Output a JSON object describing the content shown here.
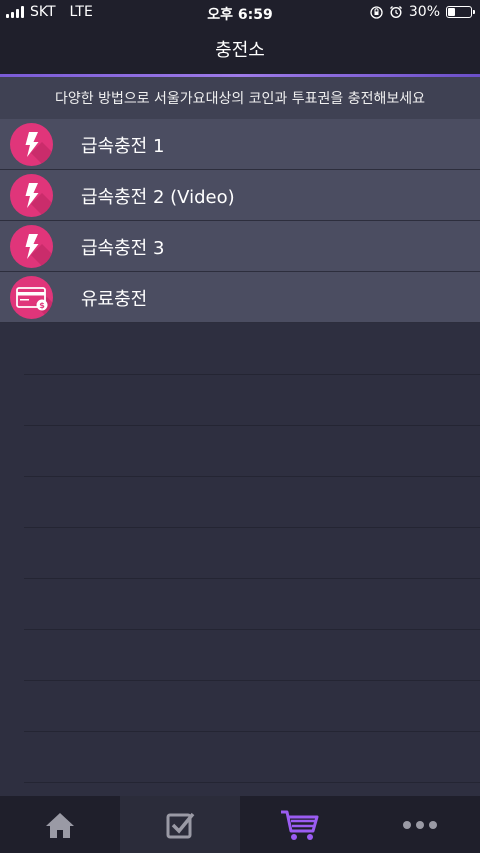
{
  "status_bar": {
    "carrier": "SKT",
    "network": "LTE",
    "time": "오후 6:59",
    "battery_percent": "30%",
    "battery_level": 0.3
  },
  "header": {
    "title": "충전소"
  },
  "notice": {
    "text": "다양한 방법으로 서울가요대상의 코인과 투표권을 충전해보세요"
  },
  "menu": {
    "items": [
      {
        "label": "급속충전 1",
        "icon": "lightning-icon"
      },
      {
        "label": "급속충전 2 (Video)",
        "icon": "lightning-icon"
      },
      {
        "label": "급속충전 3",
        "icon": "lightning-icon"
      },
      {
        "label": "유료충전",
        "icon": "credit-card-icon"
      }
    ]
  },
  "tab_bar": {
    "tabs": [
      {
        "name": "home",
        "icon": "home-icon"
      },
      {
        "name": "checklist",
        "icon": "checkbox-icon"
      },
      {
        "name": "shop",
        "icon": "cart-icon",
        "active": true
      },
      {
        "name": "more",
        "icon": "more-icon"
      }
    ]
  },
  "colors": {
    "background": "#2e2f40",
    "bar_background": "#1f1f2b",
    "list_item": "#4b4d61",
    "icon_pink": "#e0357a",
    "accent_purple": "#9b5cf2"
  }
}
